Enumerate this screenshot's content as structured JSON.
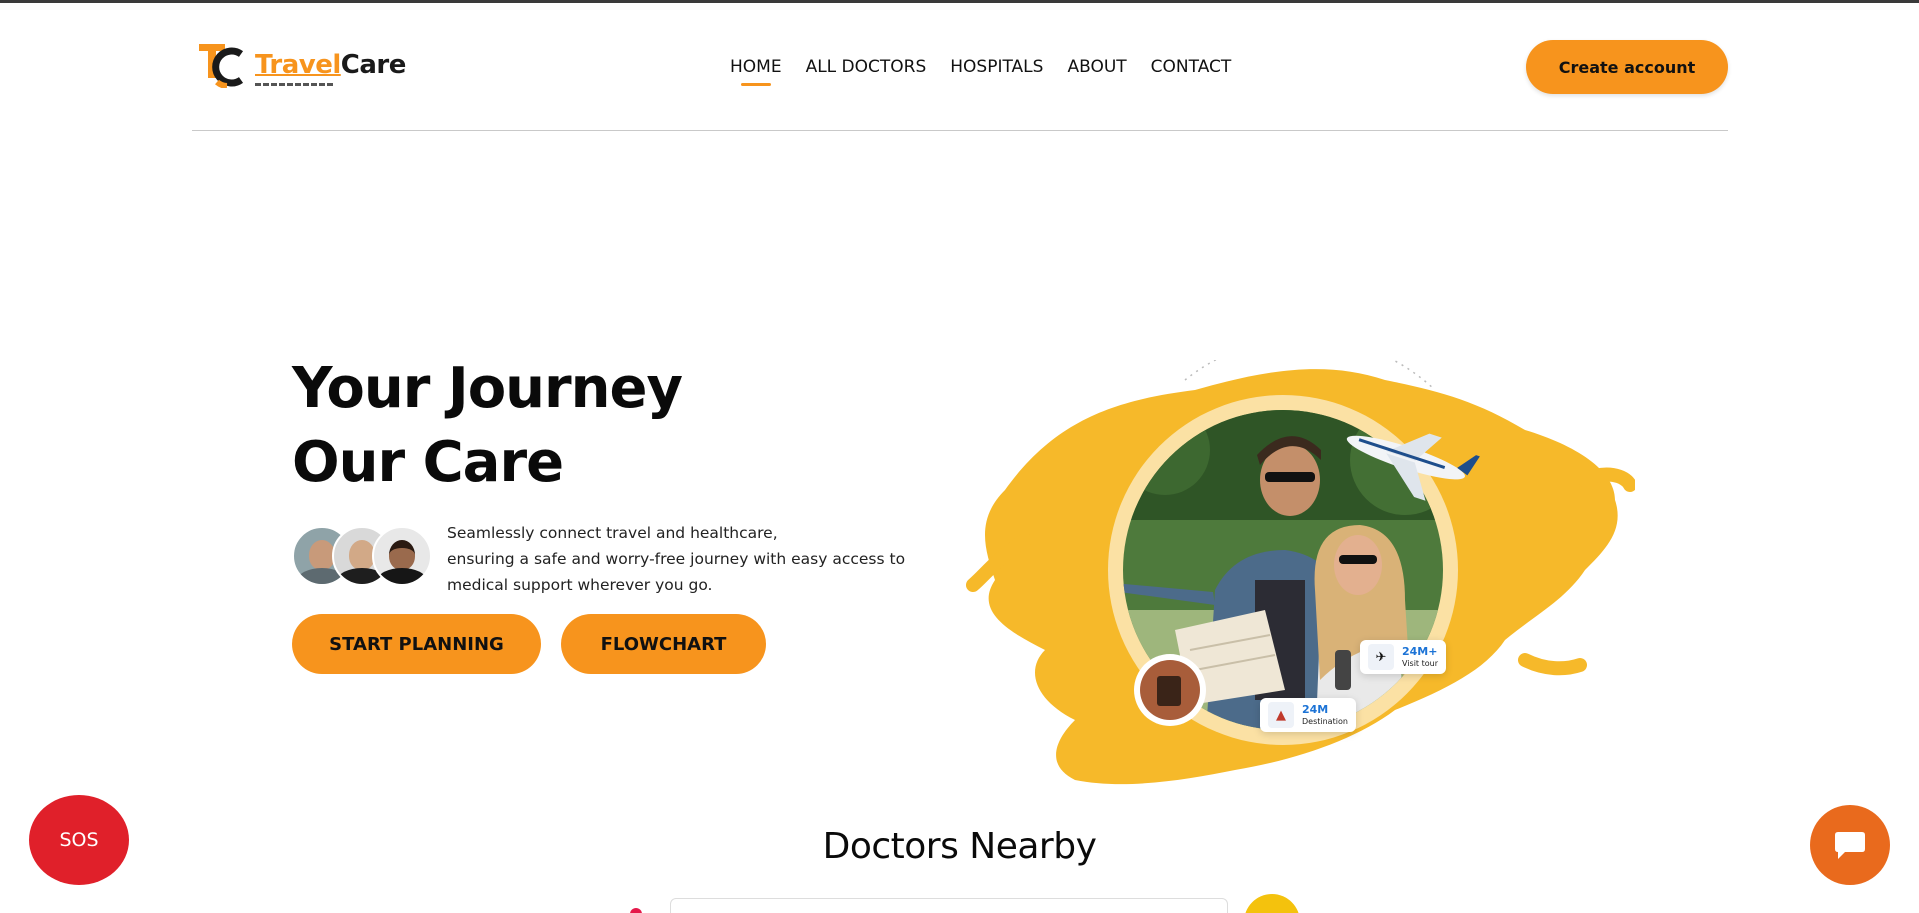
{
  "brand": {
    "name_part1": "Travel",
    "name_part2": "Care",
    "accent_color": "#f7941d"
  },
  "nav": {
    "items": [
      {
        "label": "HOME",
        "active": true
      },
      {
        "label": "ALL DOCTORS",
        "active": false
      },
      {
        "label": "HOSPITALS",
        "active": false
      },
      {
        "label": "ABOUT",
        "active": false
      },
      {
        "label": "CONTACT",
        "active": false
      }
    ],
    "cta_label": "Create account"
  },
  "hero": {
    "title_line1": "Your Journey",
    "title_line2": "Our Care",
    "desc_line1": "Seamlessly connect travel and healthcare,",
    "desc_line2": "ensuring a safe and worry-free journey with easy access to",
    "desc_line3": "medical support wherever you go.",
    "buttons": {
      "start": "START PLANNING",
      "flowchart": "FLOWCHART"
    },
    "stats": [
      {
        "value": "24M+",
        "label": "Visit tour",
        "icon": "plane-icon"
      },
      {
        "value": "24M",
        "label": "Destination",
        "icon": "landmark-icon"
      }
    ]
  },
  "doctors": {
    "title": "Doctors Nearby"
  },
  "floating": {
    "sos_label": "SOS",
    "sos_color": "#e0202a",
    "chat_icon": "chat-bubble-icon",
    "chat_color": "#e96a1d"
  }
}
